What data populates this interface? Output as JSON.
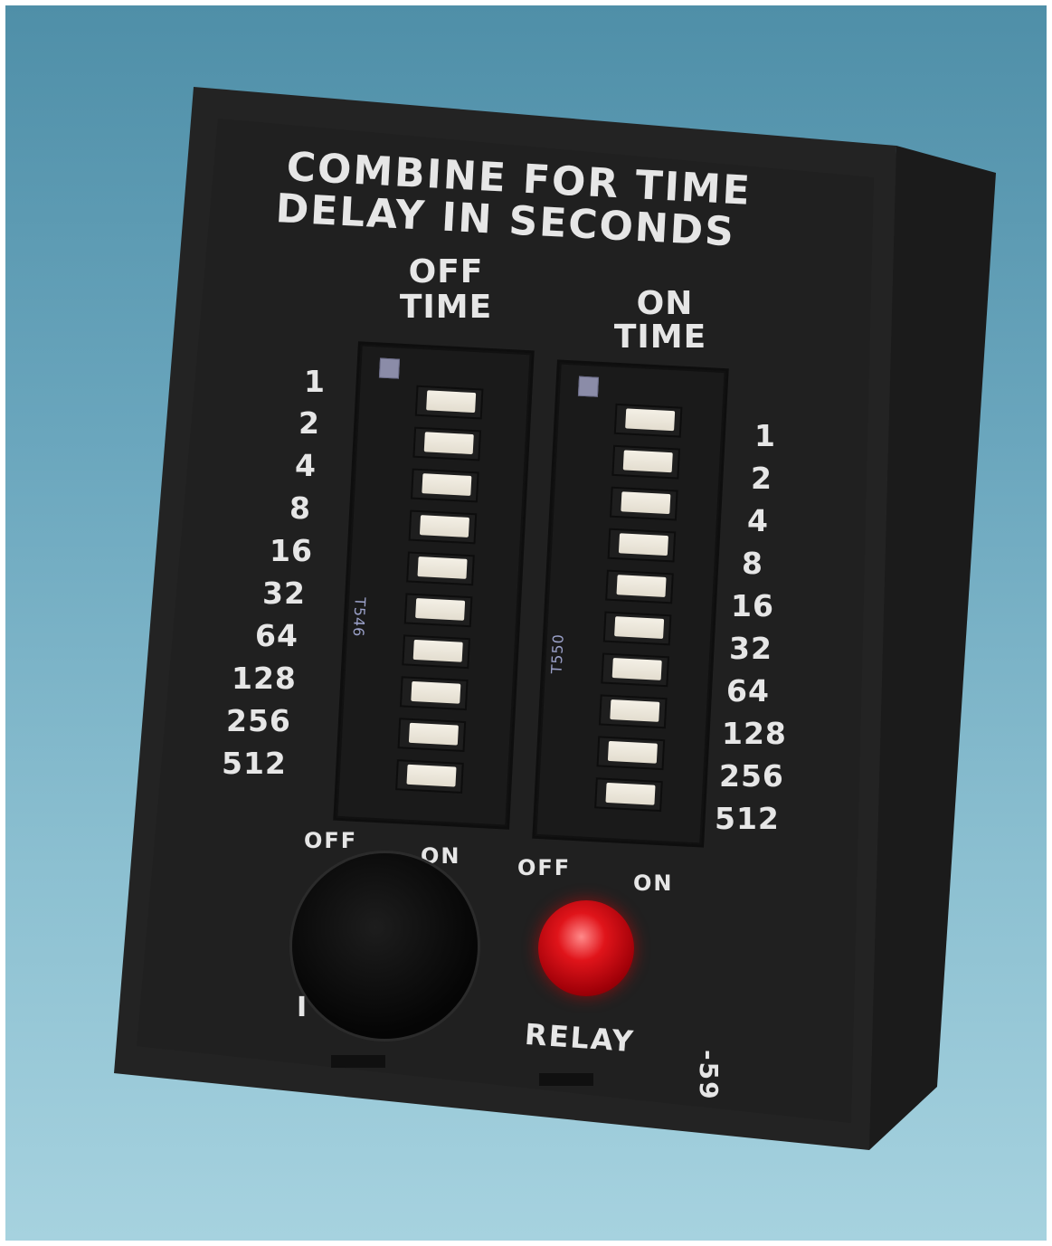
{
  "panel": {
    "heading_line1": "COMBINE FOR TIME",
    "heading_line2": "DELAY IN SECONDS"
  },
  "off_time": {
    "title_line1": "OFF",
    "title_line2": "TIME",
    "model": "T546",
    "values": [
      "1",
      "2",
      "4",
      "8",
      "16",
      "32",
      "64",
      "128",
      "256",
      "512"
    ]
  },
  "on_time": {
    "title_line1": "ON",
    "title_line2": "TIME",
    "model": "T550",
    "values": [
      "1",
      "2",
      "4",
      "8",
      "16",
      "32",
      "64",
      "128",
      "256",
      "512"
    ]
  },
  "switch_labels": {
    "off_left": "OFF",
    "on_left": "ON",
    "off_right": "OFF",
    "on_right": "ON"
  },
  "indicator": {
    "relay_label": "RELAY",
    "part_label": "-59",
    "partial_label": "I"
  },
  "colors": {
    "background": "#6aa6bd",
    "housing": "#232323",
    "print": "#e6e6e6",
    "led": "#e0141a",
    "switch_knob": "#f4f0e6"
  },
  "icons": [
    "dip-switch-icon",
    "led-indicator-icon",
    "dial-knob-icon"
  ]
}
